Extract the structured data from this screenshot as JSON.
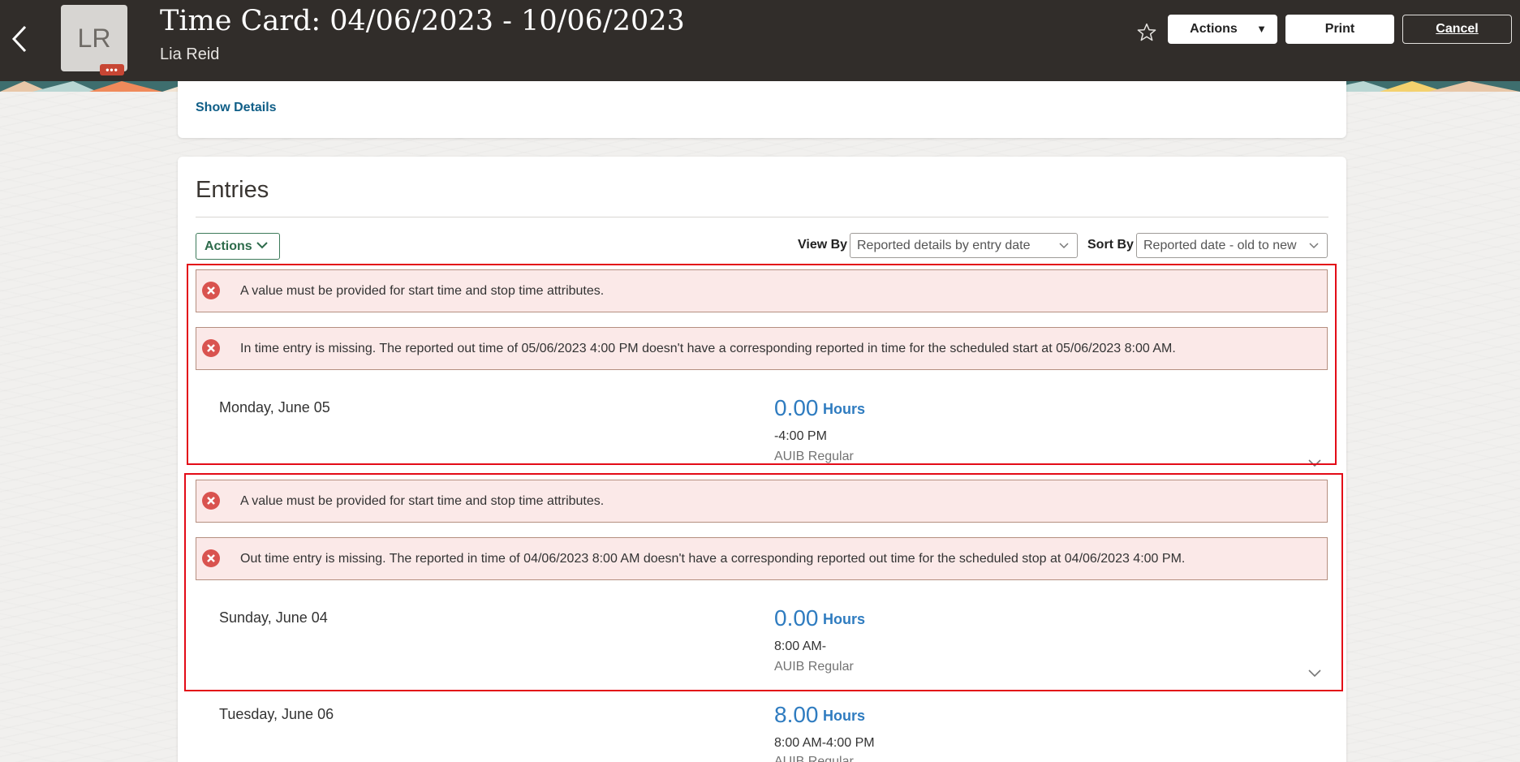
{
  "header": {
    "title": "Time Card: 04/06/2023 - 10/06/2023",
    "person_name": "Lia Reid",
    "avatar_initials": "LR",
    "avatar_badge": "•••",
    "actions_label": "Actions",
    "print_label": "Print",
    "cancel_label": "Cancel"
  },
  "summary": {
    "show_details_label": "Show Details"
  },
  "entries": {
    "title": "Entries",
    "actions_label": "Actions",
    "view_by_label": "View By",
    "view_by_value": "Reported details by entry date",
    "sort_by_label": "Sort By",
    "sort_by_value": "Reported date - old to new",
    "groups": [
      {
        "errors": [
          "A value must be provided for start time and stop time attributes.",
          "In time entry is missing. The reported out time of 05/06/2023 4:00 PM doesn't have a corresponding reported in time for the scheduled start at 05/06/2023 8:00 AM."
        ],
        "day": "Monday, June 05",
        "hours": "0.00",
        "hours_unit": "Hours",
        "time_range": "-4:00 PM",
        "type": "AUIB Regular"
      },
      {
        "errors": [
          "A value must be provided for start time and stop time attributes.",
          "Out time entry is missing. The reported in time of 04/06/2023 8:00 AM doesn't have a corresponding reported out time for the scheduled stop at 04/06/2023 4:00 PM."
        ],
        "day": "Sunday, June 04",
        "hours": "0.00",
        "hours_unit": "Hours",
        "time_range": "8:00 AM-",
        "type": "AUIB Regular"
      },
      {
        "errors": [],
        "day": "Tuesday, June 06",
        "hours": "8.00",
        "hours_unit": "Hours",
        "time_range": "8:00 AM-4:00 PM",
        "type": "AUIB Regular"
      }
    ]
  },
  "colors": {
    "header_bg": "#312d2a",
    "error_bg": "#fbe9e8",
    "error_icon": "#d9534f",
    "highlight": "#e30b17",
    "hours_blue": "#2f7cc0",
    "link_blue": "#0f5e87",
    "action_green": "#2d6b4b"
  }
}
